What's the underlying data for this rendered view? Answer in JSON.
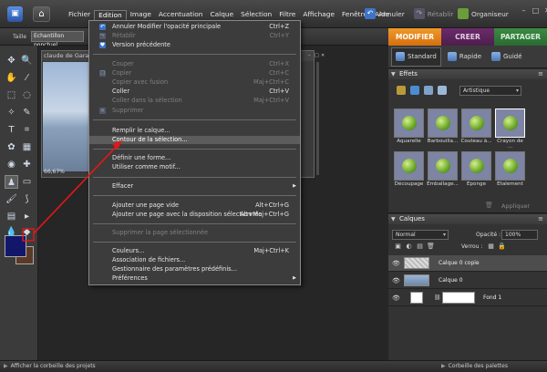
{
  "menubar": {
    "items": [
      "Fichier",
      "Edition",
      "Image",
      "Accentuation",
      "Calque",
      "Sélection",
      "Filtre",
      "Affichage",
      "Fenêtre",
      "Aide"
    ],
    "undo": "Annuler",
    "redo": "Rétablir",
    "organizer": "Organiseur"
  },
  "options_bar": {
    "size_label": "Taille",
    "tool_value": "Echantillon ponctuel"
  },
  "document": {
    "title": "claude de Garan",
    "zoom": "66,67%"
  },
  "edit_menu": {
    "items": [
      {
        "label": "Annuler Modifier l'opacité principale",
        "shortcut": "Ctrl+Z",
        "disabled": false
      },
      {
        "label": "Rétablir",
        "shortcut": "Ctrl+Y",
        "disabled": true
      },
      {
        "label": "Version précédente",
        "shortcut": "",
        "disabled": false
      },
      {
        "label": "Couper",
        "shortcut": "Ctrl+X",
        "disabled": true
      },
      {
        "label": "Copier",
        "shortcut": "Ctrl+C",
        "disabled": true
      },
      {
        "label": "Copier avec fusion",
        "shortcut": "Maj+Ctrl+C",
        "disabled": true
      },
      {
        "label": "Coller",
        "shortcut": "Ctrl+V",
        "disabled": false
      },
      {
        "label": "Coller dans la sélection",
        "shortcut": "Maj+Ctrl+V",
        "disabled": true
      },
      {
        "label": "Supprimer",
        "shortcut": "",
        "disabled": true
      },
      {
        "label": "Remplir le calque...",
        "shortcut": "",
        "disabled": false
      },
      {
        "label": "Contour de la sélection...",
        "shortcut": "",
        "disabled": false,
        "highlighted": true
      },
      {
        "label": "Définir une forme...",
        "shortcut": "",
        "disabled": false
      },
      {
        "label": "Utiliser comme motif...",
        "shortcut": "",
        "disabled": false
      },
      {
        "label": "Effacer",
        "shortcut": "",
        "disabled": false,
        "submenu": true
      },
      {
        "label": "Ajouter une page vide",
        "shortcut": "Alt+Ctrl+G",
        "disabled": false
      },
      {
        "label": "Ajouter une page avec la disposition sélectionnée",
        "shortcut": "Alt+Maj+Ctrl+G",
        "disabled": false
      },
      {
        "label": "Supprimer la page sélectionnée",
        "shortcut": "",
        "disabled": true
      },
      {
        "label": "Couleurs...",
        "shortcut": "Maj+Ctrl+K",
        "disabled": false
      },
      {
        "label": "Association de fichiers...",
        "shortcut": "",
        "disabled": false
      },
      {
        "label": "Gestionnaire des paramètres prédéfinis...",
        "shortcut": "",
        "disabled": false
      },
      {
        "label": "Préférences",
        "shortcut": "",
        "disabled": false,
        "submenu": true
      }
    ]
  },
  "mode_tabs": [
    "MODIFIER",
    "CREER",
    "PARTAGER"
  ],
  "sub_modes": [
    "Standard",
    "Rapide",
    "Guidé"
  ],
  "effects": {
    "title": "Effets",
    "category": "Artistique",
    "thumbs": [
      "Aquarelle",
      "Barbouilla...",
      "Couteau à...",
      "Crayon de ...",
      "Découpage",
      "Emballage...",
      "Eponge",
      "Etalement"
    ],
    "apply": "Appliquer"
  },
  "layers": {
    "title": "Calques",
    "blend_mode": "Normal",
    "opacity_label": "Opacité :",
    "opacity_value": "100%",
    "lock_label": "Verrou :",
    "rows": [
      {
        "name": "Calque 0 copie",
        "thumb": "checker",
        "active": true
      },
      {
        "name": "Calque 0",
        "thumb": "sky",
        "active": false
      },
      {
        "name": "Fond 1",
        "thumb": "white",
        "active": false
      }
    ]
  },
  "statusbar": {
    "project_bin": "Afficher la corbeille des projets",
    "palette_bin": "Corbeille des palettes"
  },
  "colors": {
    "foreground": "#13176a",
    "background": "#5a3a26",
    "accent_modifier": "#e8841c",
    "annotation_arrow": "#e01818"
  }
}
